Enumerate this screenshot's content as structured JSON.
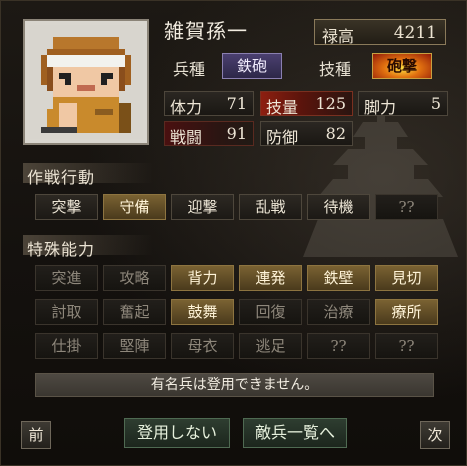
{
  "officer": {
    "name": "雑賀孫一",
    "rank_label": "禄高",
    "rank_value": "4211",
    "unit_label": "兵種",
    "unit_value": "鉄砲",
    "tech_label": "技種",
    "tech_value": "砲撃"
  },
  "stats": [
    {
      "label": "体力",
      "value": "71"
    },
    {
      "label": "技量",
      "value": "125"
    },
    {
      "label": "脚力",
      "value": "5"
    },
    {
      "label": "戦闘",
      "value": "91"
    },
    {
      "label": "防御",
      "value": "82"
    }
  ],
  "tactics": {
    "title": "作戦行動",
    "items": [
      {
        "label": "突撃",
        "state": "normal"
      },
      {
        "label": "守備",
        "state": "on"
      },
      {
        "label": "迎撃",
        "state": "normal"
      },
      {
        "label": "乱戦",
        "state": "normal"
      },
      {
        "label": "待機",
        "state": "normal"
      },
      {
        "label": "??",
        "state": "dim"
      }
    ]
  },
  "abilities": {
    "title": "特殊能力",
    "items": [
      {
        "label": "突進",
        "state": "dim"
      },
      {
        "label": "攻略",
        "state": "dim"
      },
      {
        "label": "背力",
        "state": "on"
      },
      {
        "label": "連発",
        "state": "on"
      },
      {
        "label": "鉄壁",
        "state": "on"
      },
      {
        "label": "見切",
        "state": "on"
      },
      {
        "label": "討取",
        "state": "dim"
      },
      {
        "label": "奮起",
        "state": "dim"
      },
      {
        "label": "鼓舞",
        "state": "on"
      },
      {
        "label": "回復",
        "state": "dim"
      },
      {
        "label": "治療",
        "state": "dim"
      },
      {
        "label": "療所",
        "state": "on"
      },
      {
        "label": "仕掛",
        "state": "dim"
      },
      {
        "label": "堅陣",
        "state": "dim"
      },
      {
        "label": "母衣",
        "state": "dim"
      },
      {
        "label": "逃足",
        "state": "dim"
      },
      {
        "label": "??",
        "state": "dim"
      },
      {
        "label": "??",
        "state": "dim"
      }
    ]
  },
  "message": "有名兵は登用できません。",
  "footer": {
    "prev_label": "前",
    "no_recruit_label": "登用しない",
    "to_list_label": "敵兵一覧へ",
    "next_label": "次"
  },
  "colors": {
    "active_button": "#7a6232",
    "unit_chip": "#4b4070",
    "tech_chip": "#e07010",
    "highlight_stat": "#8d1f10"
  }
}
